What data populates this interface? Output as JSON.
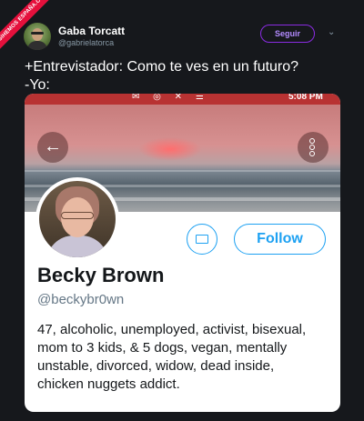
{
  "watermark": "ASIHEMOS ESPAÑA.COM",
  "tweet": {
    "author_name": "Gaba Torcatt",
    "author_handle": "@gabrielatorca",
    "follow_label": "Seguir",
    "text_lines": [
      "+Entrevistador: Como te ves en un futuro?",
      "-Yo:"
    ]
  },
  "embedded_profile": {
    "status_time": "5:08 PM",
    "display_name": "Becky Brown",
    "handle": "@beckybr0wn",
    "follow_label": "Follow",
    "bio_lines": [
      "47, alcoholic, unemployed, activist, bisexual,",
      "mom to 3 kids, & 5 dogs, vegan, mentally",
      "unstable, divorced, widow, dead inside,",
      "chicken nuggets addict."
    ]
  },
  "colors": {
    "background": "#16181c",
    "twitter_blue": "#1da1f2",
    "follow_purple": "#8a2be2",
    "ribbon_red": "#e5103c"
  }
}
